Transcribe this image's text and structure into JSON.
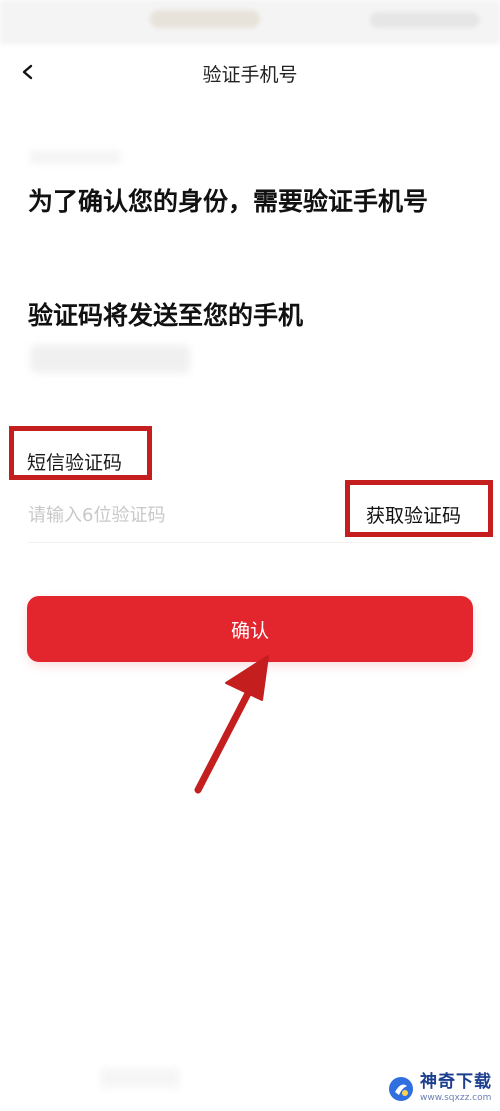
{
  "nav": {
    "title": "验证手机号",
    "back_icon": "chevron-left-icon"
  },
  "content": {
    "heading_identity": "为了确认您的身份，需要验证手机号",
    "heading_send": "验证码将发送至您的手机"
  },
  "sms_field": {
    "label": "短信验证码",
    "placeholder": "请输入6位验证码",
    "value": "",
    "get_code_label": "获取验证码"
  },
  "confirm_button": {
    "label": "确认"
  },
  "annotations": {
    "highlight_color": "#c41e1e",
    "arrow_color": "#c41e1e"
  },
  "theme": {
    "accent": "#e3262d"
  },
  "watermark": {
    "name": "神奇下载",
    "url": "www.sqxzz.com"
  }
}
